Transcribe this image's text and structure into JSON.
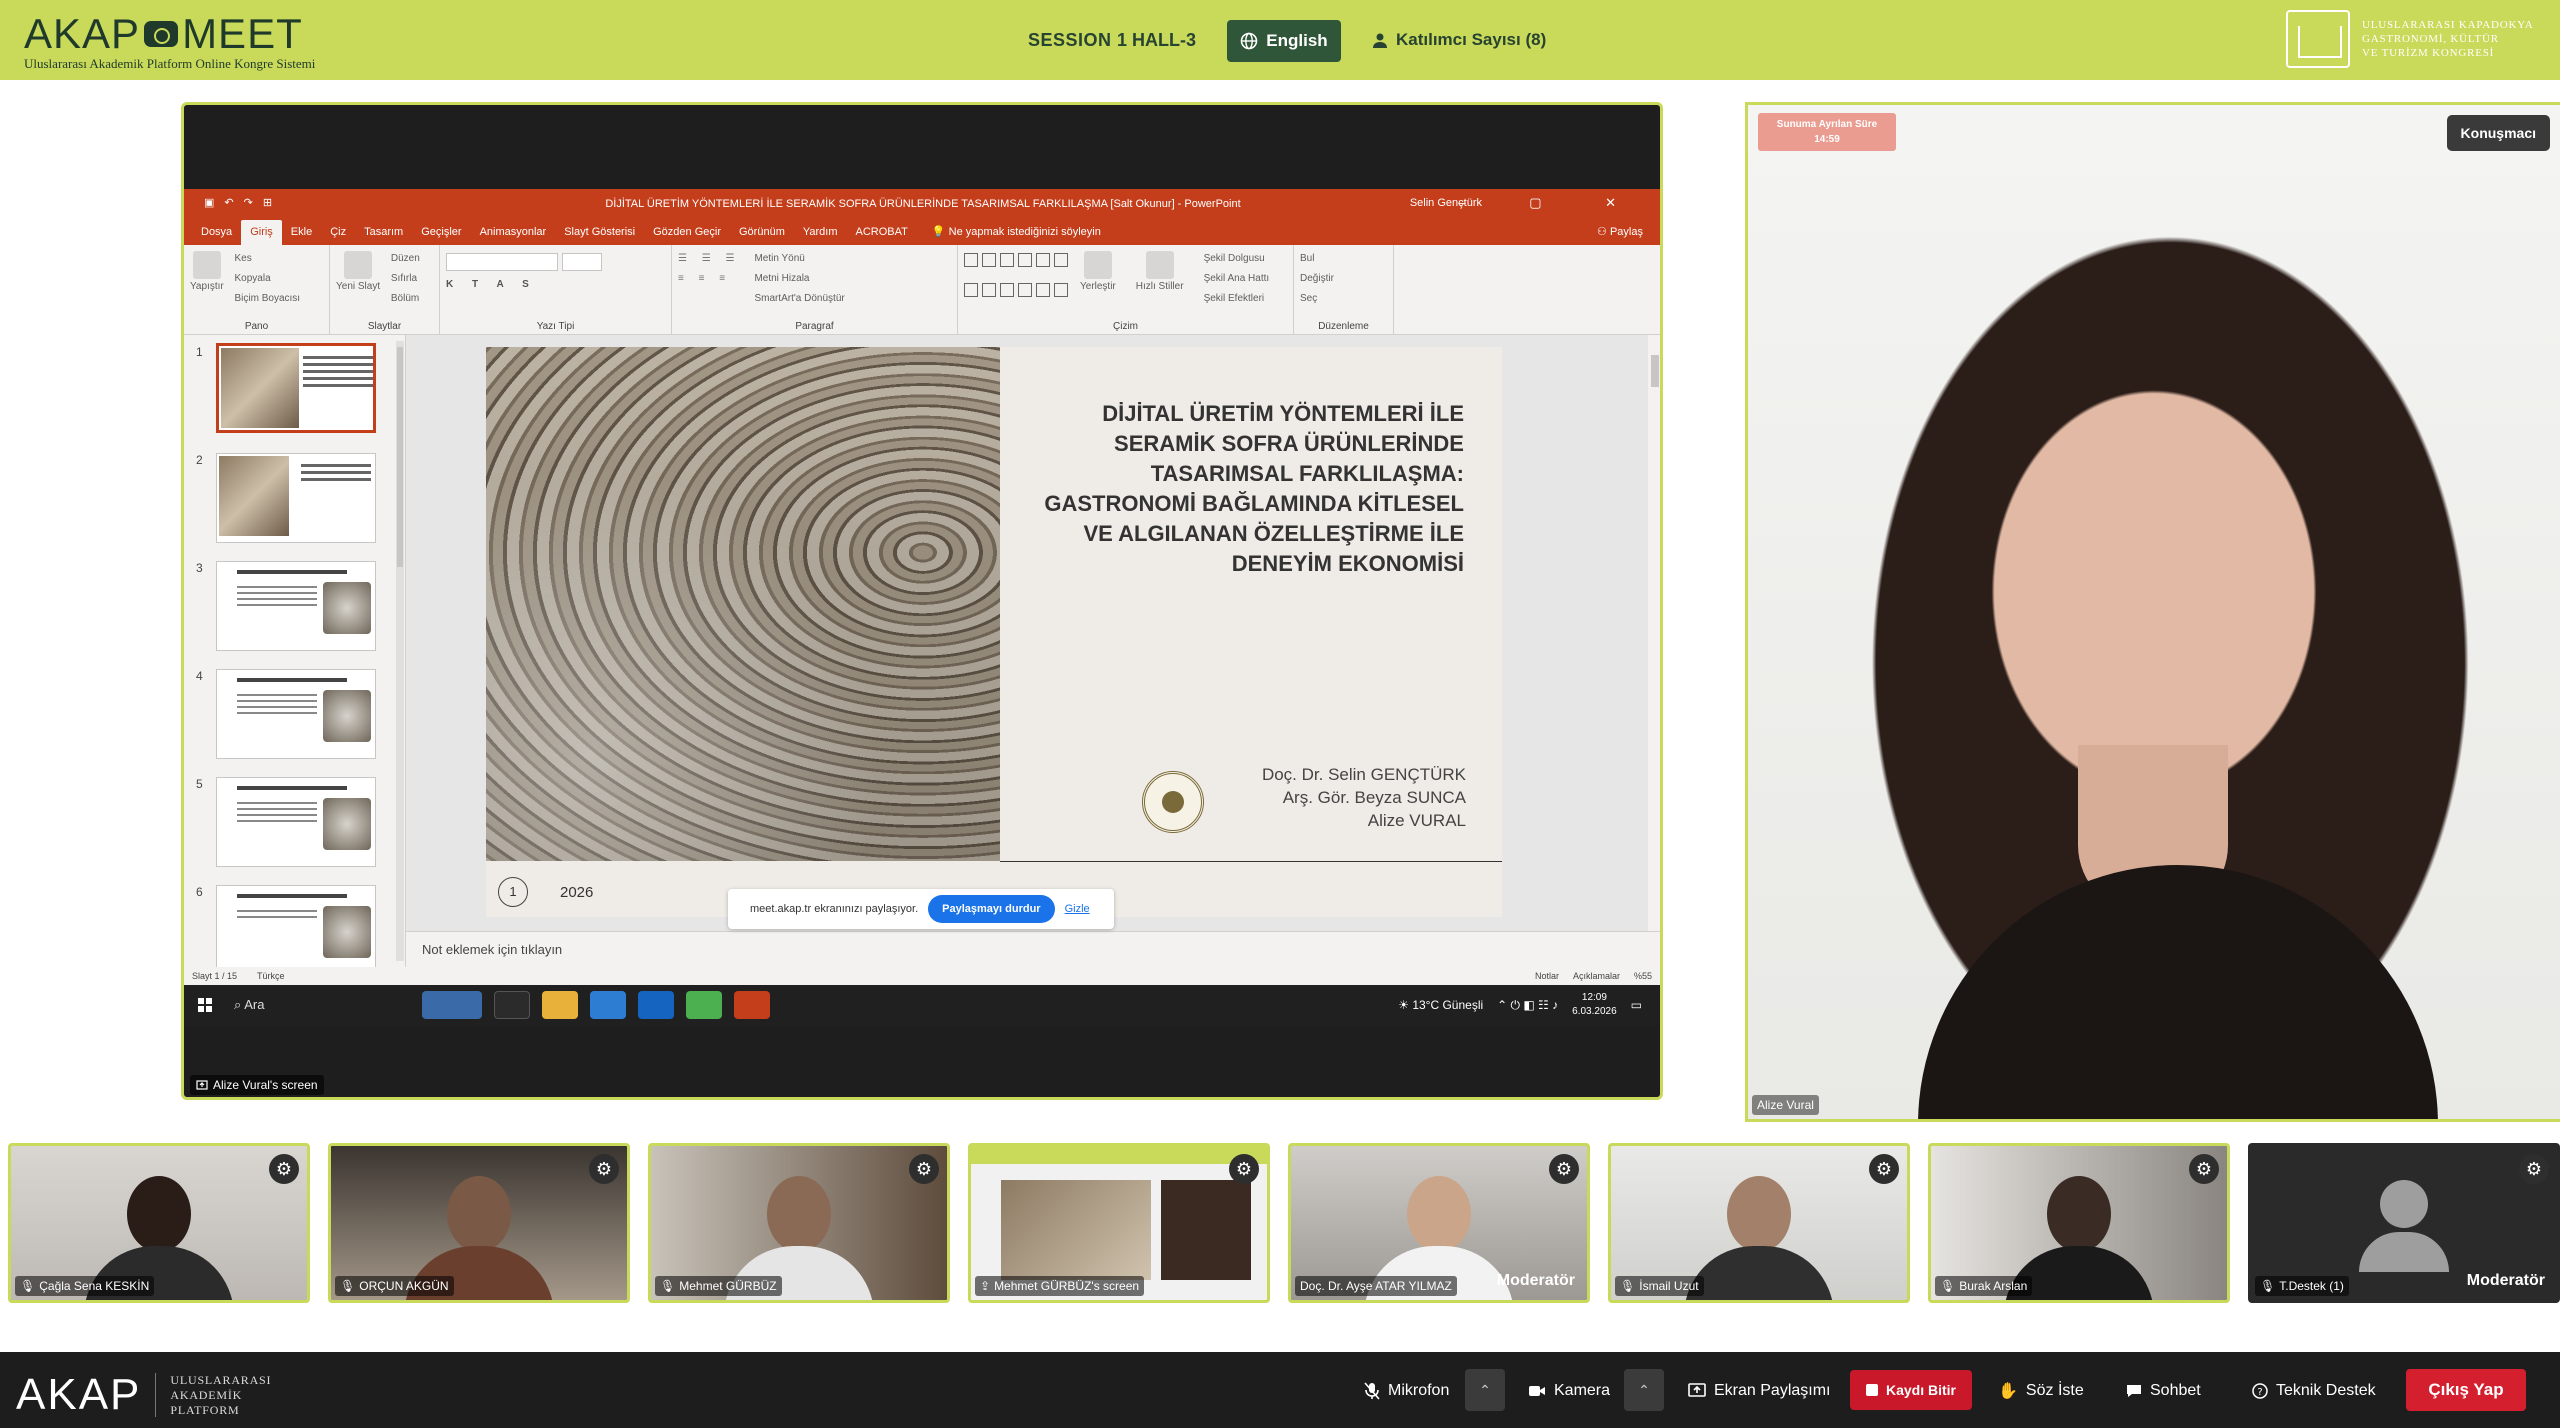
{
  "header": {
    "logo": "AKAP",
    "logo_suffix": "MEET",
    "logo_subtitle": "Uluslararası Akademik Platform Online Kongre Sistemi",
    "session": "SESSION 1",
    "hall": "HALL-3",
    "language": "English",
    "participants": "Katılımcı Sayısı (8)",
    "congress_lines": [
      "ULUSLARARASI KAPADOKYA",
      "GASTRONOMİ, KÜLTÜR",
      "VE TURİZM KONGRESİ"
    ]
  },
  "powerpoint": {
    "window_title": "DİJİTAL ÜRETİM YÖNTEMLERİ İLE SERAMİK SOFRA ÜRÜNLERİNDE TASARIMSAL FARKLILAŞMA [Salt Okunur]  -  PowerPoint",
    "user": "Selin Gençtürk",
    "tabs": [
      "Dosya",
      "Giriş",
      "Ekle",
      "Çiz",
      "Tasarım",
      "Geçişler",
      "Animasyonlar",
      "Slayt Gösterisi",
      "Gözden Geçir",
      "Görünüm",
      "Yardım",
      "ACROBAT"
    ],
    "active_tab": "Giriş",
    "tell_me": "Ne yapmak istediğinizi söyleyin",
    "share": "Paylaş",
    "ribbon": {
      "pano": {
        "label": "Pano",
        "paste": "Yapıştır",
        "items": [
          "Kes",
          "Kopyala",
          "Biçim Boyacısı"
        ]
      },
      "slaytlar": {
        "label": "Slaytlar",
        "new": "Yeni Slayt",
        "items": [
          "Düzen",
          "Sıfırla",
          "Bölüm"
        ]
      },
      "yazi_tipi": {
        "label": "Yazı Tipi"
      },
      "paragraf": {
        "label": "Paragraf",
        "items": [
          "Metin Yönü",
          "Metni Hizala",
          "SmartArt'a Dönüştür"
        ]
      },
      "cizim": {
        "label": "Çizim",
        "arrange": "Yerleştir",
        "styles": "Hızlı Stiller",
        "items": [
          "Şekil Dolgusu",
          "Şekil Ana Hattı",
          "Şekil Efektleri"
        ]
      },
      "duzenleme": {
        "label": "Düzenleme",
        "items": [
          "Bul",
          "Değiştir",
          "Seç"
        ]
      }
    },
    "thumb_numbers": [
      "1",
      "2",
      "3",
      "4",
      "5",
      "6"
    ],
    "slide": {
      "title": "DİJİTAL ÜRETİM YÖNTEMLERİ İLE SERAMİK SOFRA ÜRÜNLERİNDE TASARIMSAL FARKLILAŞMA: GASTRONOMİ BAĞLAMINDA KİTLESEL VE ALGILANAN ÖZELLEŞTİRME İLE DENEYİM EKONOMİSİ",
      "authors": [
        "Doç. Dr. Selin GENÇTÜRK",
        "Arş. Gör. Beyza SUNCA",
        "Alize VURAL"
      ],
      "number": "1",
      "year": "2026"
    },
    "notes_placeholder": "Not eklemek için tıklayın",
    "status": {
      "slide_counter": "Slayt 1 / 15",
      "language": "Türkçe",
      "notes": "Notlar",
      "comments": "Açıklamalar",
      "zoom": "%55"
    }
  },
  "share_bar": {
    "text": "meet.akap.tr ekranınızı paylaşıyor.",
    "stop": "Paylaşmayı durdur",
    "hide": "Gizle"
  },
  "taskbar": {
    "search": "Ara",
    "weather": "13°C  Güneşli",
    "time": "12:09",
    "date": "6.03.2026"
  },
  "screen_label": "Alize Vural's screen",
  "speaker": {
    "timer_label": "Sunuma Ayrılan Süre",
    "timer_value": "14:59",
    "role": "Konuşmacı",
    "name": "Alize Vural"
  },
  "participants": [
    {
      "name": "Çağla Sena KESKİN",
      "moderator": ""
    },
    {
      "name": "ORÇUN AKGÜN",
      "moderator": ""
    },
    {
      "name": "Mehmet GÜRBÜZ",
      "moderator": ""
    },
    {
      "name": "Mehmet GÜRBÜZ's screen",
      "moderator": ""
    },
    {
      "name": "Doç. Dr. Ayşe ATAR YILMAZ",
      "moderator": "Moderatör"
    },
    {
      "name": "İsmail Uzut",
      "moderator": ""
    },
    {
      "name": "Burak Arslan",
      "moderator": ""
    },
    {
      "name": "T.Destek (1)",
      "moderator": "Moderatör"
    }
  ],
  "footer": {
    "logo": "AKAP",
    "logo_lines": [
      "ULUSLARARASI",
      "AKADEMİK",
      "PLATFORM"
    ],
    "mic": "Mikrofon",
    "camera": "Kamera",
    "screen_share": "Ekran Paylaşımı",
    "record": "Kaydı Bitir",
    "raise_hand": "Söz İste",
    "chat": "Sohbet",
    "support": "Teknik Destek",
    "exit": "Çıkış Yap"
  }
}
